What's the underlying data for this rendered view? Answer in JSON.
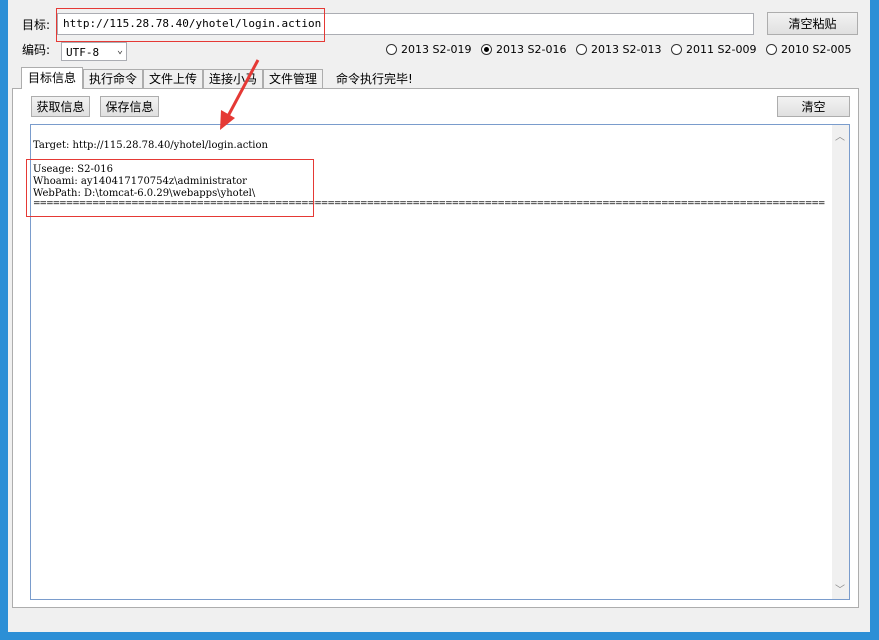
{
  "target": {
    "label": "目标:",
    "url": "http://115.28.78.40/yhotel/login.action",
    "clear_paste_button": "清空粘贴"
  },
  "encoding": {
    "label": "编码:",
    "selected": "UTF-8"
  },
  "exploits": [
    {
      "label": "2013 S2-019",
      "checked": false
    },
    {
      "label": "2013 S2-016",
      "checked": true
    },
    {
      "label": "2013 S2-013",
      "checked": false
    },
    {
      "label": "2011 S2-009",
      "checked": false
    },
    {
      "label": "2010 S2-005",
      "checked": false
    }
  ],
  "tabs": [
    "目标信息",
    "执行命令",
    "文件上传",
    "连接小马",
    "文件管理"
  ],
  "status": "命令执行完毕!",
  "toolbar": {
    "get_info": "获取信息",
    "save_info": "保存信息",
    "clear": "清空"
  },
  "output": {
    "target_line": "Target: http://115.28.78.40/yhotel/login.action",
    "usage_line": "Useage: S2-016",
    "whoami_line": "Whoami: ay140417170754z\\administrator",
    "webpath_line": "WebPath: D:\\tomcat-6.0.29\\webapps\\yhotel\\",
    "separator": "================================================================================================================================================"
  },
  "colors": {
    "frame": "#2c8fd6",
    "annotation": "#e53935",
    "output_border": "#7a9ccc"
  }
}
